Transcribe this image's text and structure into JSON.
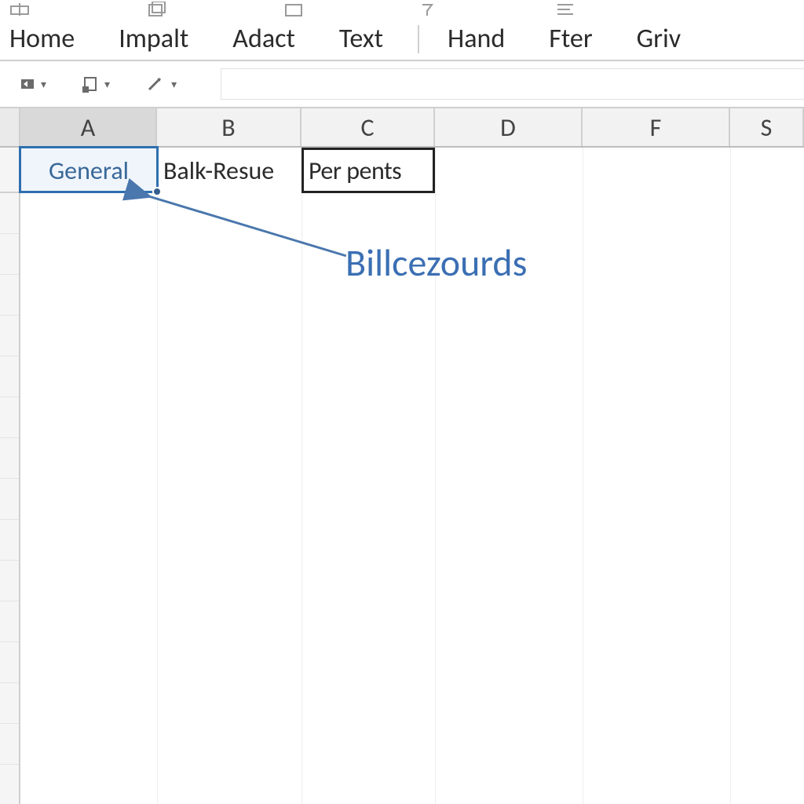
{
  "ribbon": {
    "tabs": [
      "Home",
      "Impalt",
      "Adact",
      "Text",
      "Hand",
      "Fter",
      "Griv"
    ]
  },
  "columns": [
    "A",
    "B",
    "C",
    "D",
    "F",
    "S"
  ],
  "cells": {
    "A1": "General",
    "B1": "Balk-Resue",
    "C1": "Per pents"
  },
  "annotation": {
    "label": "Billcezourds"
  }
}
